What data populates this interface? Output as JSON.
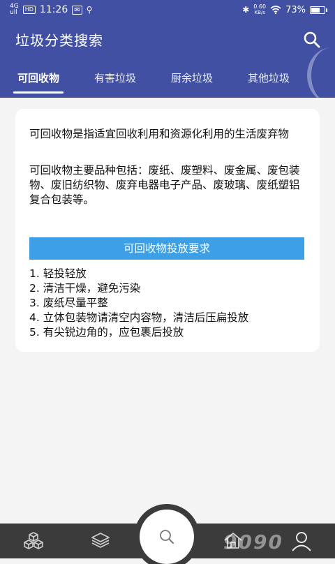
{
  "status_bar": {
    "network_top": "4G",
    "network_bottom": "ull",
    "hd_badge": "HD",
    "time": "11:26",
    "speed_top": "0.60",
    "speed_bottom": "KB/s",
    "battery": "73%",
    "battery_level": 0.73
  },
  "header": {
    "title": "垃圾分类搜索",
    "search_icon": "search-icon",
    "tabs": [
      {
        "label": "可回收物",
        "active": true
      },
      {
        "label": "有害垃圾",
        "active": false
      },
      {
        "label": "厨余垃圾",
        "active": false
      },
      {
        "label": "其他垃圾",
        "active": false
      }
    ]
  },
  "content": {
    "definition": "可回收物是指适宜回收利用和资源化利用的生活废弃物",
    "types": "可回收物主要品种包括：废纸、废塑料、废金属、废包装物、废旧纺织物、废弃电器电子产品、废玻璃、废纸塑铝复合包装等。",
    "requirements_title": "可回收物投放要求",
    "requirements": [
      "1. 轻投轻放",
      "2. 清洁干燥，避免污染",
      "3. 废纸尽量平整",
      "4. 立体包装物请清空内容物，清洁后压扁投放",
      "5. 有尖锐边角的，应包裹后投放"
    ]
  },
  "bottom_nav": {
    "items": [
      "cubes-icon",
      "layers-icon",
      "search-icon",
      "home-icon",
      "user-icon"
    ],
    "watermark": "9090"
  },
  "colors": {
    "header": "#4150a3",
    "accent": "#3da0e6",
    "bottom_bar": "#3b3b3b"
  }
}
